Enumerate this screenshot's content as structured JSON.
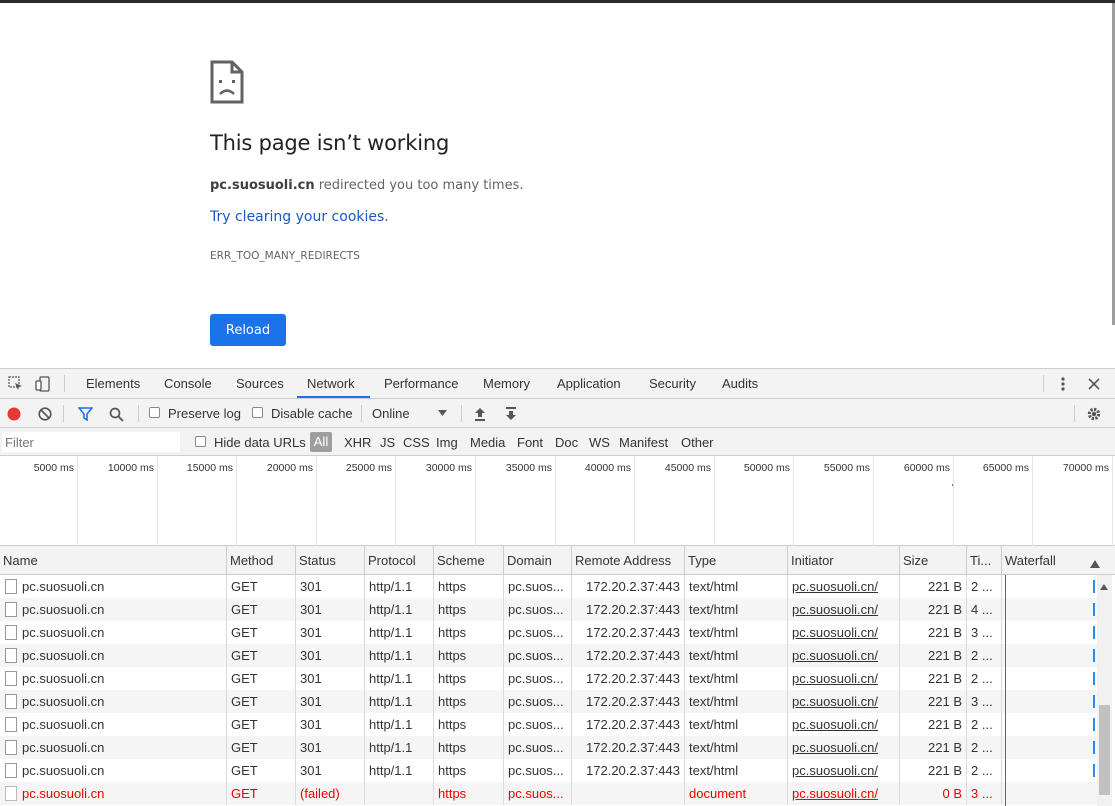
{
  "page": {
    "title": "This page isn’t working",
    "domain": "pc.suosuoli.cn",
    "message_rest": " redirected you too many times.",
    "link": "Try clearing your cookies.",
    "error_code": "ERR_TOO_MANY_REDIRECTS",
    "reload_label": "Reload"
  },
  "devtools": {
    "tabs": [
      "Elements",
      "Console",
      "Sources",
      "Network",
      "Performance",
      "Memory",
      "Application",
      "Security",
      "Audits"
    ],
    "active_tab": "Network",
    "toolbar": {
      "preserve_log": "Preserve log",
      "disable_cache": "Disable cache",
      "throttle": "Online"
    },
    "filter": {
      "placeholder": "Filter",
      "hide_data_urls": "Hide data URLs",
      "types": [
        "All",
        "XHR",
        "JS",
        "CSS",
        "Img",
        "Media",
        "Font",
        "Doc",
        "WS",
        "Manifest",
        "Other"
      ]
    },
    "overview_ticks": [
      "5000 ms",
      "10000 ms",
      "15000 ms",
      "20000 ms",
      "25000 ms",
      "30000 ms",
      "35000 ms",
      "40000 ms",
      "45000 ms",
      "50000 ms",
      "55000 ms",
      "60000 ms",
      "65000 ms",
      "70000 ms"
    ],
    "columns": [
      "Name",
      "Method",
      "Status",
      "Protocol",
      "Scheme",
      "Domain",
      "Remote Address",
      "Type",
      "Initiator",
      "Size",
      "Ti...",
      "Waterfall"
    ],
    "rows": [
      {
        "name": "pc.suosuoli.cn",
        "method": "GET",
        "status": "301",
        "protocol": "http/1.1",
        "scheme": "https",
        "domain": "pc.suos...",
        "remote": "172.20.2.37:443",
        "type": "text/html",
        "initiator": "pc.suosuoli.cn/",
        "size": "221 B",
        "time": "2 ..."
      },
      {
        "name": "pc.suosuoli.cn",
        "method": "GET",
        "status": "301",
        "protocol": "http/1.1",
        "scheme": "https",
        "domain": "pc.suos...",
        "remote": "172.20.2.37:443",
        "type": "text/html",
        "initiator": "pc.suosuoli.cn/",
        "size": "221 B",
        "time": "4 ..."
      },
      {
        "name": "pc.suosuoli.cn",
        "method": "GET",
        "status": "301",
        "protocol": "http/1.1",
        "scheme": "https",
        "domain": "pc.suos...",
        "remote": "172.20.2.37:443",
        "type": "text/html",
        "initiator": "pc.suosuoli.cn/",
        "size": "221 B",
        "time": "3 ..."
      },
      {
        "name": "pc.suosuoli.cn",
        "method": "GET",
        "status": "301",
        "protocol": "http/1.1",
        "scheme": "https",
        "domain": "pc.suos...",
        "remote": "172.20.2.37:443",
        "type": "text/html",
        "initiator": "pc.suosuoli.cn/",
        "size": "221 B",
        "time": "2 ..."
      },
      {
        "name": "pc.suosuoli.cn",
        "method": "GET",
        "status": "301",
        "protocol": "http/1.1",
        "scheme": "https",
        "domain": "pc.suos...",
        "remote": "172.20.2.37:443",
        "type": "text/html",
        "initiator": "pc.suosuoli.cn/",
        "size": "221 B",
        "time": "2 ..."
      },
      {
        "name": "pc.suosuoli.cn",
        "method": "GET",
        "status": "301",
        "protocol": "http/1.1",
        "scheme": "https",
        "domain": "pc.suos...",
        "remote": "172.20.2.37:443",
        "type": "text/html",
        "initiator": "pc.suosuoli.cn/",
        "size": "221 B",
        "time": "3 ..."
      },
      {
        "name": "pc.suosuoli.cn",
        "method": "GET",
        "status": "301",
        "protocol": "http/1.1",
        "scheme": "https",
        "domain": "pc.suos...",
        "remote": "172.20.2.37:443",
        "type": "text/html",
        "initiator": "pc.suosuoli.cn/",
        "size": "221 B",
        "time": "2 ..."
      },
      {
        "name": "pc.suosuoli.cn",
        "method": "GET",
        "status": "301",
        "protocol": "http/1.1",
        "scheme": "https",
        "domain": "pc.suos...",
        "remote": "172.20.2.37:443",
        "type": "text/html",
        "initiator": "pc.suosuoli.cn/",
        "size": "221 B",
        "time": "2 ..."
      },
      {
        "name": "pc.suosuoli.cn",
        "method": "GET",
        "status": "301",
        "protocol": "http/1.1",
        "scheme": "https",
        "domain": "pc.suos...",
        "remote": "172.20.2.37:443",
        "type": "text/html",
        "initiator": "pc.suosuoli.cn/",
        "size": "221 B",
        "time": "2 ..."
      },
      {
        "name": "pc.suosuoli.cn",
        "method": "GET",
        "status": "(failed)",
        "protocol": "",
        "scheme": "https",
        "domain": "pc.suos...",
        "remote": "",
        "type": "document",
        "initiator": "pc.suosuoli.cn/",
        "size": "0 B",
        "time": "3 ...",
        "failed": true
      }
    ],
    "colors": {
      "accent": "#1a73e8",
      "failed": "#ee0000",
      "record": "#e53935"
    }
  }
}
